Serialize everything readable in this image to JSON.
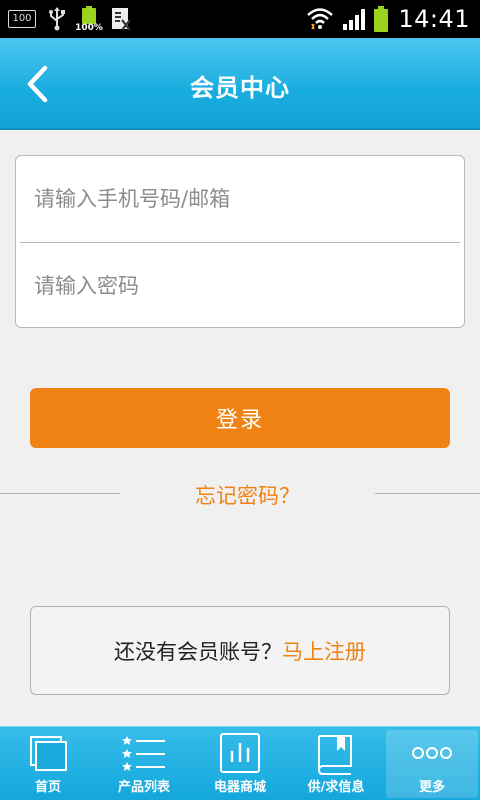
{
  "status_bar": {
    "storage_badge": "100",
    "battery_badge": "100%",
    "time": "14:41"
  },
  "header": {
    "title": "会员中心"
  },
  "login_form": {
    "account_placeholder": "请输入手机号码/邮箱",
    "password_placeholder": "请输入密码",
    "submit_label": "登录"
  },
  "forgot_password": {
    "label": "忘记密码？"
  },
  "register": {
    "prompt": "还没有会员账号？",
    "link": "马上注册"
  },
  "tab_bar": {
    "items": [
      {
        "label": "首页",
        "icon": "home-icon"
      },
      {
        "label": "产品列表",
        "icon": "list-icon"
      },
      {
        "label": "电器商城",
        "icon": "chart-icon"
      },
      {
        "label": "供/求信息",
        "icon": "book-icon"
      },
      {
        "label": "更多",
        "icon": "more-icon"
      }
    ],
    "active_index": 4
  },
  "colors": {
    "header_blue": "#19acdf",
    "accent_orange": "#f08313",
    "background": "#f0f0f0"
  }
}
